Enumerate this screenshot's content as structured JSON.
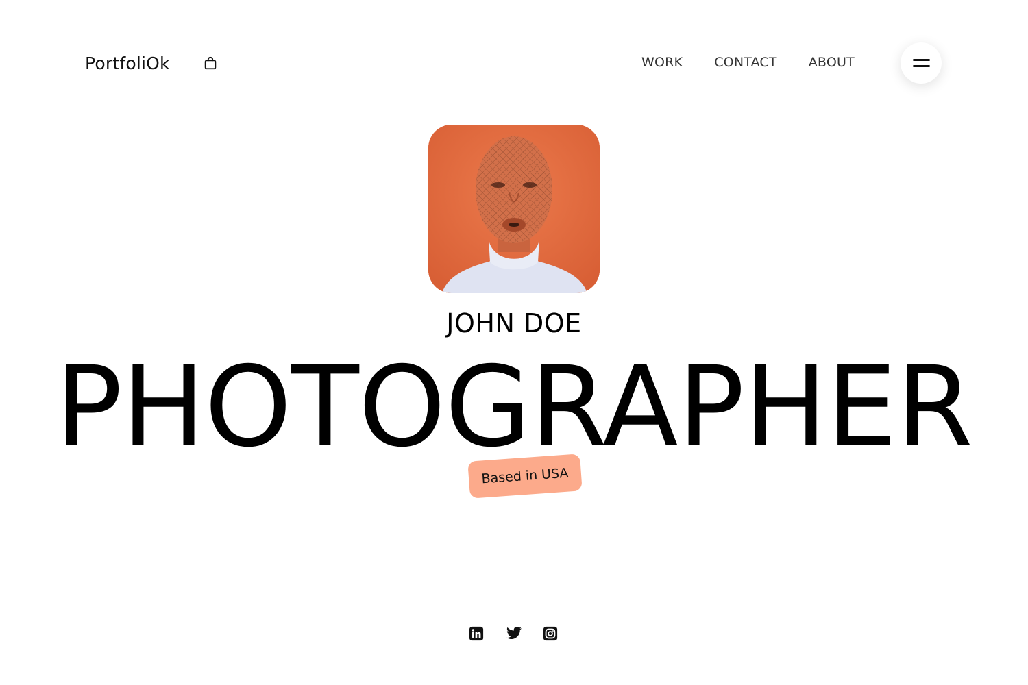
{
  "header": {
    "logo": "PortfoliOk",
    "cart_icon": "shopping-bag-icon",
    "nav": [
      {
        "label": "WORK"
      },
      {
        "label": "CONTACT"
      },
      {
        "label": "ABOUT"
      }
    ],
    "menu_icon": "hamburger-menu-icon"
  },
  "hero": {
    "name": "JOHN DOE",
    "title": "PHOTOGRAPHER",
    "badge": "Based in USA",
    "badge_color": "#fcaa8b",
    "portrait_bg": "#e0683f"
  },
  "social": [
    {
      "icon": "linkedin-icon"
    },
    {
      "icon": "twitter-icon"
    },
    {
      "icon": "instagram-icon"
    }
  ]
}
